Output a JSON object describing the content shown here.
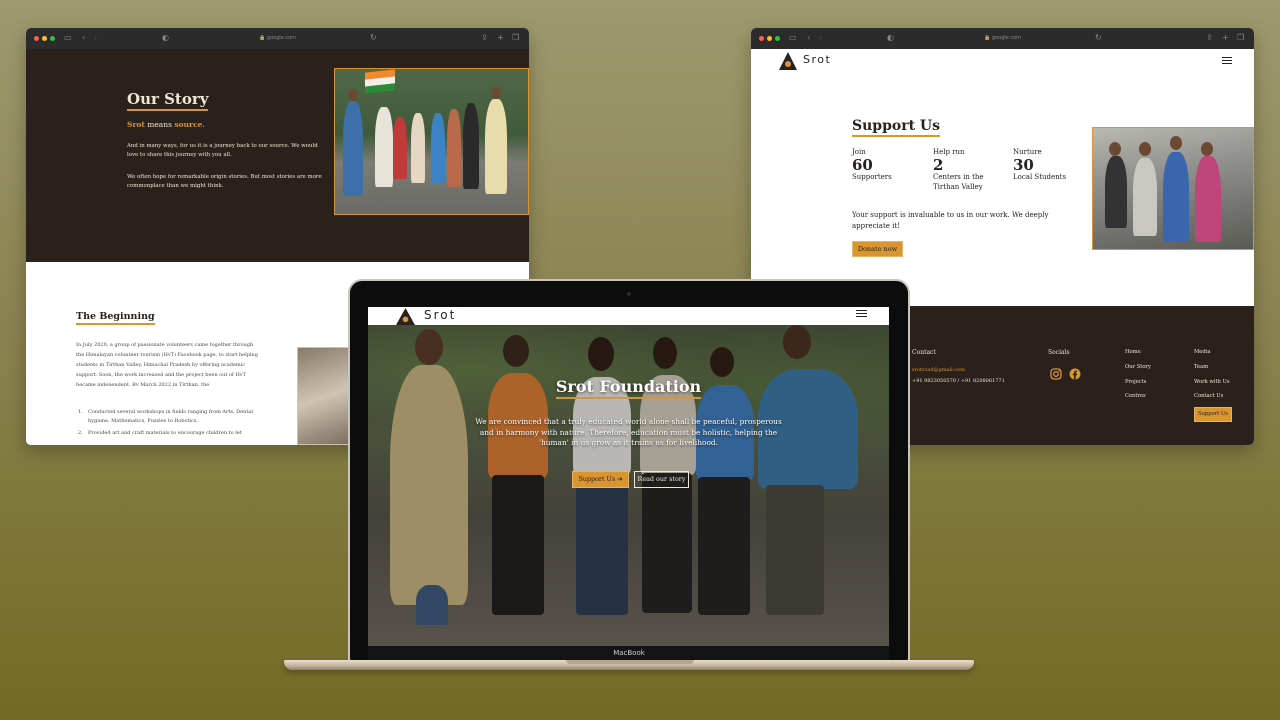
{
  "browser": {
    "url": "google.com"
  },
  "story": {
    "title": "Our Story",
    "srot_word": "Srot",
    "means_word": " means ",
    "source_word": "source.",
    "para1": "And in many ways, for us it is a journey back to our source. We would love to share this journey with you all.",
    "para2": "We often hope for remarkable origin stories. But most stories are more commonplace than we might think.",
    "beginning_title": "The Beginning",
    "beginning_para": "In July 2020, a group of passionate volunteers came together through the Himalayan volunteer tourism (HvT) Facebook page, to start helping students in Tirthan Valley, Himachal Pradesh by offering academic support. Soon, the work increased and the project been out of HvT became independent. By March 2022 in Tirthan, the",
    "list": [
      "Conducted several workshops in fields ranging from Arts, Dental hygiene, Mathematics, Puzzles to Robotics.",
      "Provided art and craft materials to encourage children to let"
    ]
  },
  "support": {
    "logo_text": "Srot",
    "title": "Support Us",
    "stats": [
      {
        "label": "Join",
        "value": "60",
        "desc": "Supporters"
      },
      {
        "label": "Help run",
        "value": "2",
        "desc": "Centers in the Tirthan Valley"
      },
      {
        "label": "Nurture",
        "value": "30",
        "desc": "Local Students"
      }
    ],
    "text": "Your support is invaluable to us in our work. We deeply appreciate it!",
    "donate": "Donate now"
  },
  "footer": {
    "contact_heading": "Contact",
    "email": "srotroad@gmail.com",
    "phone": "+91 9823050570 / +91 8208061771",
    "socials_heading": "Socials",
    "col1": [
      "Home",
      "Our Story",
      "Projects",
      "Centres"
    ],
    "col2": [
      "Media",
      "Team",
      "Work with Us",
      "Contact Us"
    ],
    "support_btn": "Support Us"
  },
  "hero": {
    "logo_text": "Srot",
    "title": "Srot Foundation",
    "text": "We are convinced that a truly educated world alone shall be peaceful, prosperous and in harmony with nature. Therefore, education must be holistic, helping the 'human' in us grow as it trains us for livelihood.",
    "btn_support": "Support Us",
    "btn_story": "Read our story"
  },
  "laptop": {
    "label": "MacBook"
  },
  "colors": {
    "accent": "#d9952f",
    "dark": "#2a211c",
    "cream": "#f0e6d4"
  }
}
